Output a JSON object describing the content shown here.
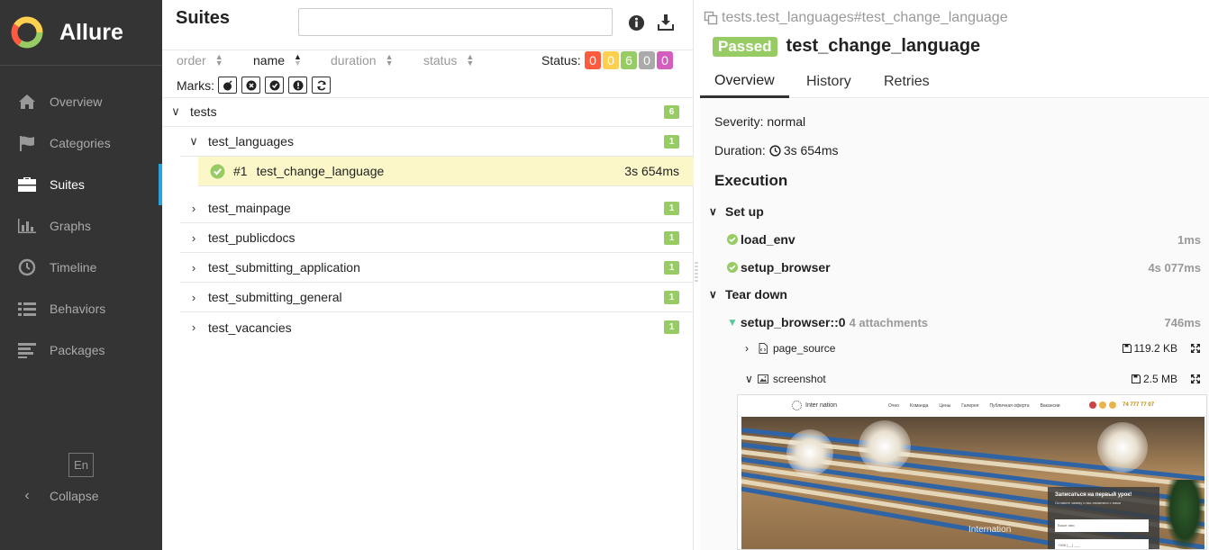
{
  "app": {
    "brand": "Allure"
  },
  "sidebar": {
    "items": [
      {
        "label": "Overview",
        "icon": "home-icon",
        "active": false
      },
      {
        "label": "Categories",
        "icon": "flag-icon",
        "active": false
      },
      {
        "label": "Suites",
        "icon": "briefcase-icon",
        "active": true
      },
      {
        "label": "Graphs",
        "icon": "bar-chart-icon",
        "active": false
      },
      {
        "label": "Timeline",
        "icon": "clock-icon",
        "active": false
      },
      {
        "label": "Behaviors",
        "icon": "list-icon",
        "active": false
      },
      {
        "label": "Packages",
        "icon": "align-left-icon",
        "active": false
      }
    ],
    "language": "En",
    "collapse": "Collapse"
  },
  "suites": {
    "title": "Suites",
    "search": {
      "value": "",
      "placeholder": ""
    },
    "sort": {
      "order": "order",
      "name": "name",
      "duration": "duration",
      "status": "status"
    },
    "status_label": "Status:",
    "status_counts": [
      {
        "value": "0",
        "color": "#fd5a3e"
      },
      {
        "value": "0",
        "color": "#ffd050"
      },
      {
        "value": "6",
        "color": "#97cc64"
      },
      {
        "value": "0",
        "color": "#aaaaaa"
      },
      {
        "value": "0",
        "color": "#d35ebe"
      }
    ],
    "marks_label": "Marks:",
    "tree": {
      "root": {
        "label": "tests",
        "count": "6"
      },
      "group": {
        "label": "test_languages",
        "count": "1"
      },
      "selected_test": {
        "index": "#1",
        "label": "test_change_language",
        "duration": "3s 654ms"
      },
      "others": [
        {
          "label": "test_mainpage",
          "count": "1"
        },
        {
          "label": "test_publicdocs",
          "count": "1"
        },
        {
          "label": "test_submitting_application",
          "count": "1"
        },
        {
          "label": "test_submitting_general",
          "count": "1"
        },
        {
          "label": "test_vacancies",
          "count": "1"
        }
      ]
    }
  },
  "detail": {
    "path": "tests.test_languages#test_change_language",
    "status": "Passed",
    "title": "test_change_language",
    "tabs": [
      "Overview",
      "History",
      "Retries"
    ],
    "severity": "Severity: normal",
    "duration_label": "Duration:",
    "duration": "3s 654ms",
    "execution": "Execution",
    "setup": {
      "label": "Set up",
      "steps": [
        {
          "name": "load_env",
          "duration": "1ms"
        },
        {
          "name": "setup_browser",
          "duration": "4s 077ms"
        }
      ]
    },
    "teardown": {
      "label": "Tear down",
      "step": {
        "name": "setup_browser::0",
        "attachments": "4 attachments",
        "duration": "746ms"
      },
      "attachments": [
        {
          "name": "page_source",
          "size": "119.2 KB"
        },
        {
          "name": "screenshot",
          "size": "2.5 MB"
        }
      ]
    },
    "screenshot": {
      "logo": "Inter nation",
      "nav": [
        "Очно",
        "Команда",
        "Цены",
        "Галерея",
        "Публичная оферта",
        "Вакансии"
      ],
      "phone": "74 777 77 07",
      "form_title": "Записаться на первый урок!",
      "form_sub": "Оставьте заявку и мы свяжемся с вами",
      "form_field1": "Ваше имя",
      "form_field2": "+998 (__) ___",
      "brand_overlay": "Internation"
    }
  }
}
